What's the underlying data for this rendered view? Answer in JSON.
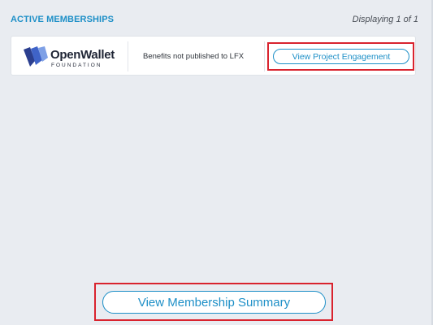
{
  "section": {
    "title": "ACTIVE MEMBERSHIPS",
    "pagination": "Displaying 1 of 1"
  },
  "membership": {
    "org_logo": {
      "name": "OpenWallet",
      "sub": "FOUNDATION"
    },
    "benefits_text": "Benefits not published to LFX",
    "action_label": "View Project Engagement"
  },
  "footer": {
    "summary_label": "View Membership Summary"
  },
  "colors": {
    "accent": "#1d8fc7",
    "highlight": "#d9232e",
    "background": "#e9ecf1"
  },
  "icons": {
    "logo": "openwallet-logo-icon"
  }
}
